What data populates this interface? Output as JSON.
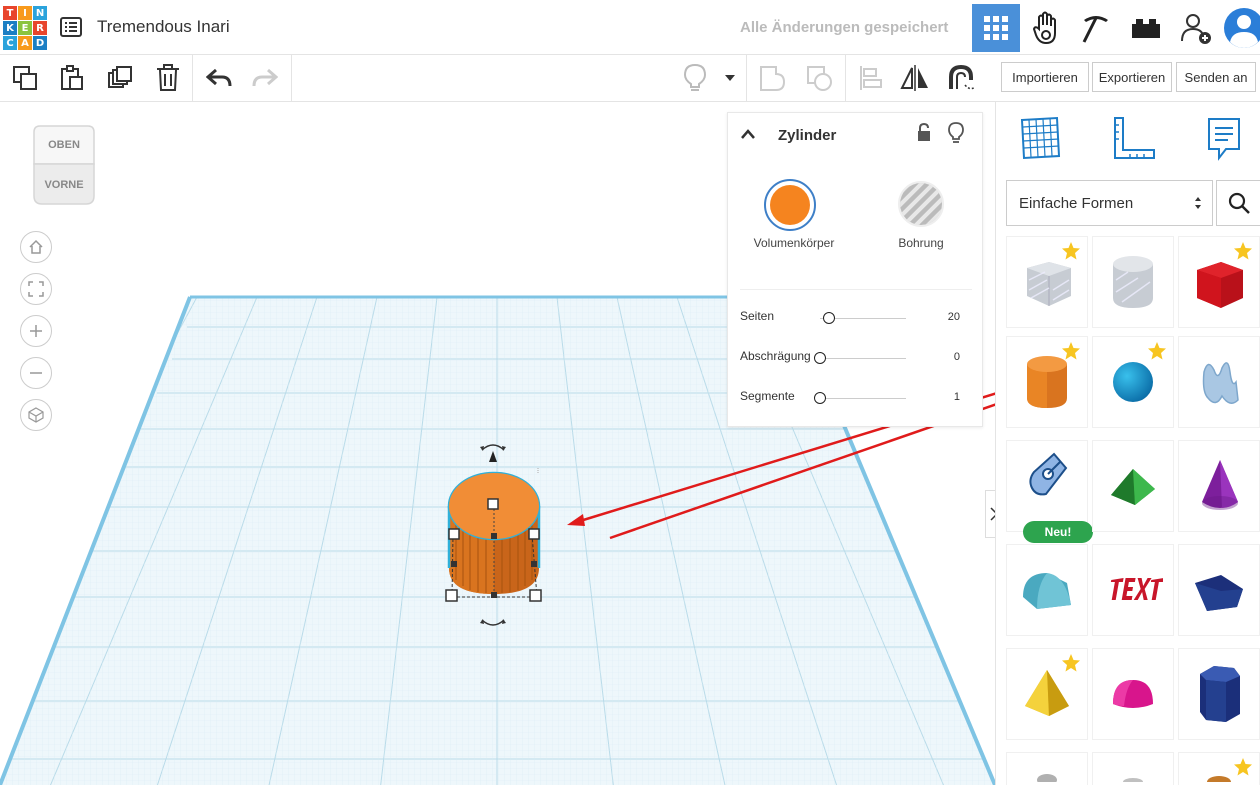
{
  "app": {
    "logo_letters": [
      "T",
      "I",
      "N",
      "K",
      "E",
      "R",
      "C",
      "A",
      "D"
    ],
    "title": "Tremendous Inari",
    "save_status": "Alle Änderungen gespeichert"
  },
  "header_icons": [
    "grid-view-icon",
    "hand-icon",
    "pickaxe-icon",
    "brick-icon",
    "add-user-icon",
    "profile-avatar-icon"
  ],
  "toolbar": {
    "buttons": [
      "copy-icon",
      "paste-icon",
      "duplicate-icon",
      "delete-icon",
      "undo-icon",
      "redo-icon",
      "light-bulb-icon",
      "group-icon",
      "ungroup-icon",
      "align-icon",
      "mirror-icon",
      "magnet-icon"
    ],
    "import_label": "Importieren",
    "export_label": "Exportieren",
    "send_label": "Senden an"
  },
  "viewcube": {
    "top_label": "OBEN",
    "front_label": "VORNE"
  },
  "inspector": {
    "title": "Zylinder",
    "solid_label": "Volumenkörper",
    "hole_label": "Bohrung",
    "solid_color": "#f5841f",
    "properties": [
      {
        "label": "Seiten",
        "value": "20",
        "fraction": 0.1
      },
      {
        "label": "Abschrägung",
        "value": "0",
        "fraction": 0.0
      },
      {
        "label": "Segmente",
        "value": "1",
        "fraction": 0.0
      }
    ]
  },
  "panel": {
    "category": "Einfache Formen",
    "new_badge": "Neu!",
    "shapes": [
      {
        "name": "box-hole",
        "star": true
      },
      {
        "name": "cylinder-hole",
        "star": false
      },
      {
        "name": "box",
        "star": true
      },
      {
        "name": "cylinder",
        "star": true
      },
      {
        "name": "sphere",
        "star": true
      },
      {
        "name": "scribble",
        "star": false
      },
      {
        "name": "shape-generator",
        "star": false,
        "new": true
      },
      {
        "name": "roof",
        "star": false
      },
      {
        "name": "cone",
        "star": false
      },
      {
        "name": "round-roof",
        "star": false
      },
      {
        "name": "text",
        "star": false
      },
      {
        "name": "wedge",
        "star": false
      },
      {
        "name": "pyramid",
        "star": true
      },
      {
        "name": "half-sphere",
        "star": false
      },
      {
        "name": "polygon",
        "star": false
      }
    ]
  },
  "colors": {
    "accent": "#4a90d9",
    "cylinder": "#f5841f",
    "grid_line": "#c8e4ef",
    "arrow": "#e01b1b"
  }
}
